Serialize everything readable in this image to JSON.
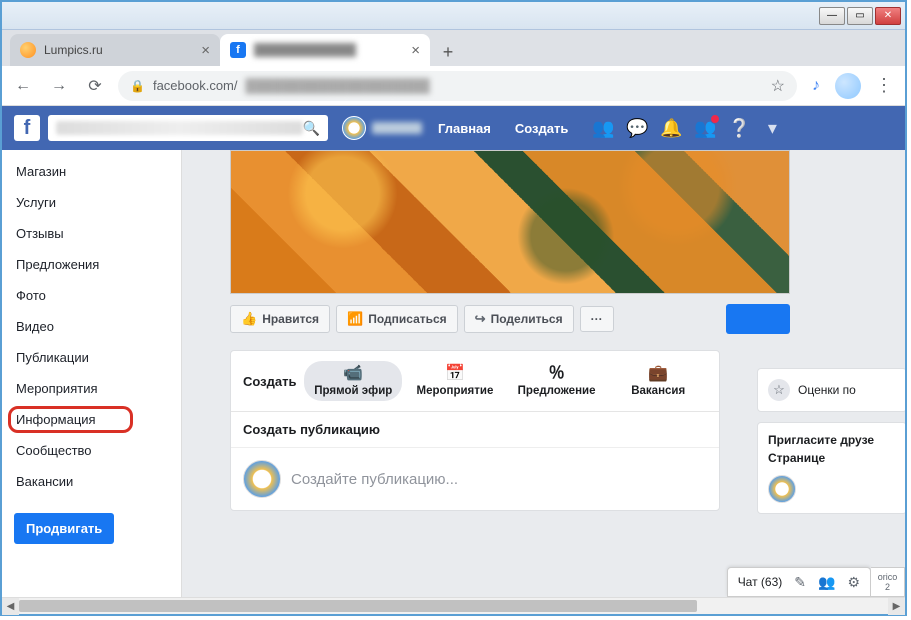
{
  "window": {
    "min": "—",
    "max": "▭",
    "close": "✕"
  },
  "tabs": {
    "t1": {
      "title": "Lumpics.ru"
    },
    "t2": {
      "title": "Facebook"
    },
    "new": "+"
  },
  "addr": {
    "back": "←",
    "fwd": "→",
    "reload": "⟳",
    "lock": "🔒",
    "host": "facebook.com/",
    "star": "☆",
    "ext": "♪",
    "menu": "⋮"
  },
  "fb": {
    "logo": "f",
    "search_icon": "🔍",
    "home": "Главная",
    "create": "Создать"
  },
  "sidebar_items": [
    "Магазин",
    "Услуги",
    "Отзывы",
    "Предложения",
    "Фото",
    "Видео",
    "Публикации",
    "Мероприятия",
    "Информация",
    "Сообщество",
    "Вакансии"
  ],
  "promote": "Продвигать",
  "actions": {
    "like": "Нравится",
    "follow": "Подписаться",
    "share": "Поделиться",
    "more": "···"
  },
  "create_section": {
    "label": "Создать",
    "live": "Прямой эфир",
    "event": "Мероприятие",
    "offer": "Предложение",
    "job": "Вакансия"
  },
  "post": {
    "head": "Создать публикацию",
    "placeholder": "Создайте публикацию..."
  },
  "rr": {
    "reviews": "Оценки по",
    "invite": "Пригласите друзе",
    "invite2": "Странице"
  },
  "chat": {
    "label": "Чат (63)",
    "extra": "orico",
    "extra2": "2"
  },
  "scroll": {
    "l": "◀",
    "r": "▶"
  }
}
